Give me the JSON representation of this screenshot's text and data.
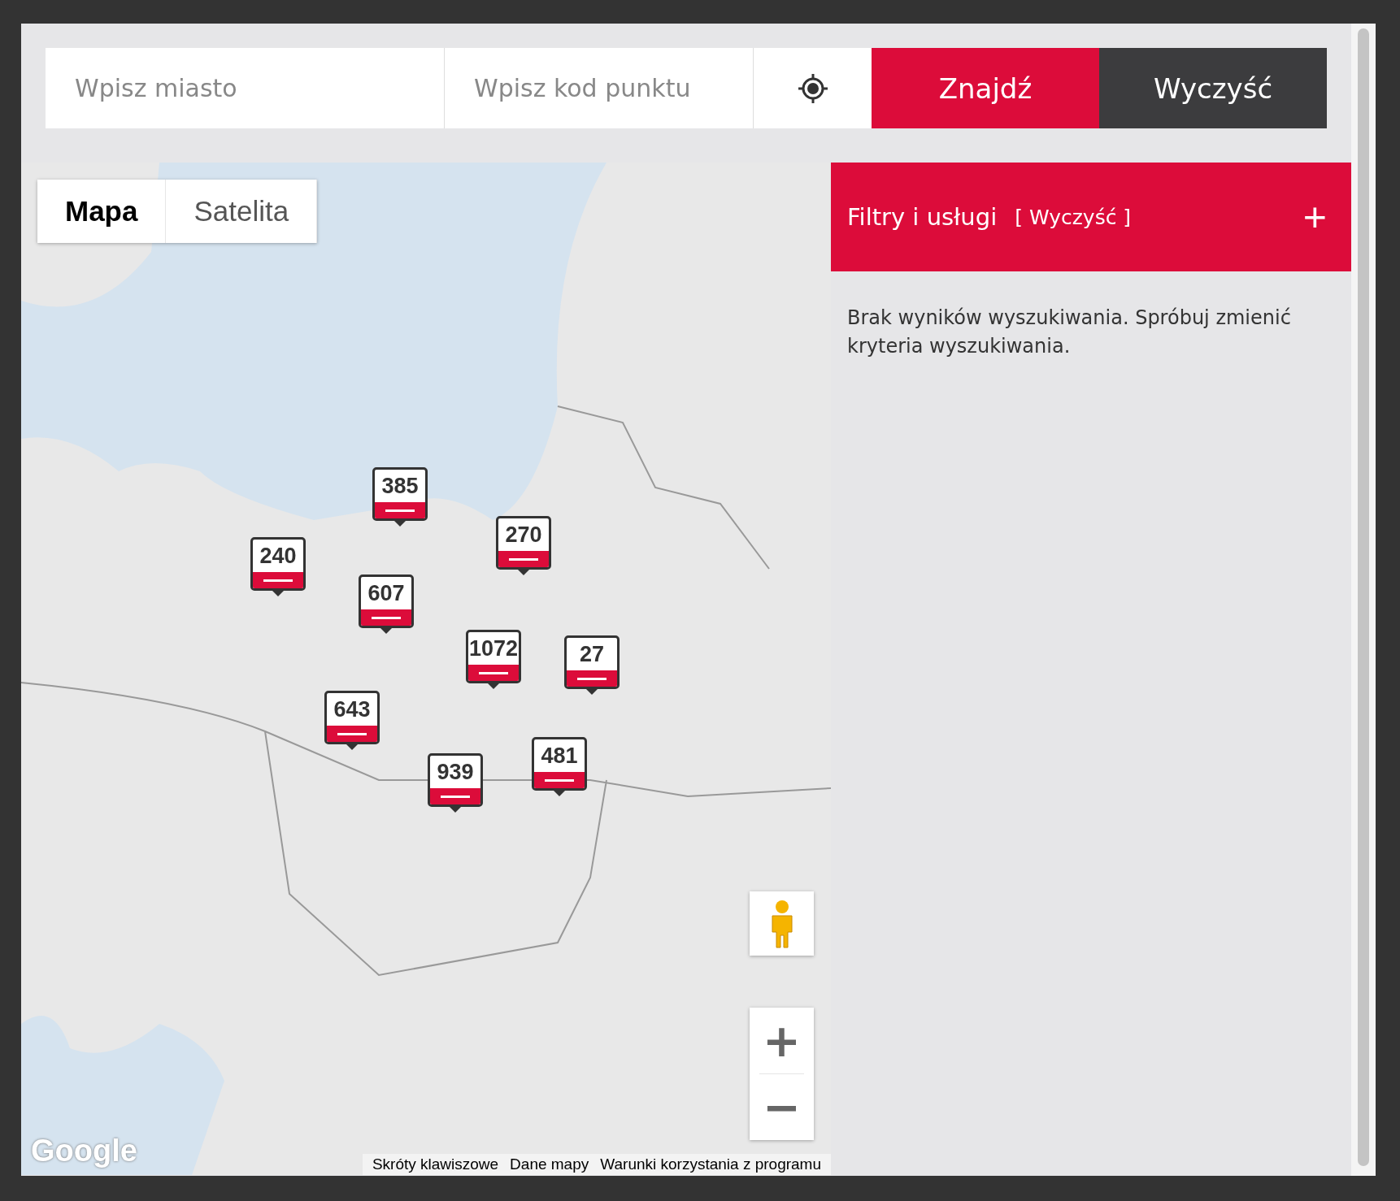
{
  "search": {
    "city_placeholder": "Wpisz miasto",
    "code_placeholder": "Wpisz kod punktu",
    "find_button": "Znajdź",
    "clear_button": "Wyczyść"
  },
  "map": {
    "type_tabs": [
      {
        "label": "Mapa",
        "selected": true
      },
      {
        "label": "Satelita",
        "selected": false
      }
    ],
    "clusters": [
      {
        "count": "385"
      },
      {
        "count": "240"
      },
      {
        "count": "270"
      },
      {
        "count": "607"
      },
      {
        "count": "1072"
      },
      {
        "count": "27"
      },
      {
        "count": "643"
      },
      {
        "count": "939"
      },
      {
        "count": "481"
      }
    ],
    "zoom_in": "+",
    "zoom_out": "−",
    "logo": "Google",
    "footer_links": [
      "Skróty klawiszowe",
      "Dane mapy",
      "Warunki korzystania z programu"
    ]
  },
  "filters": {
    "title": "Filtry i usługi",
    "clear_link": "[ Wyczyść ]",
    "expand": "+",
    "expanded": false
  },
  "results": {
    "message": "Brak wyników wyszukiwania. Spróbuj zmienić kryteria wyszukiwania."
  }
}
